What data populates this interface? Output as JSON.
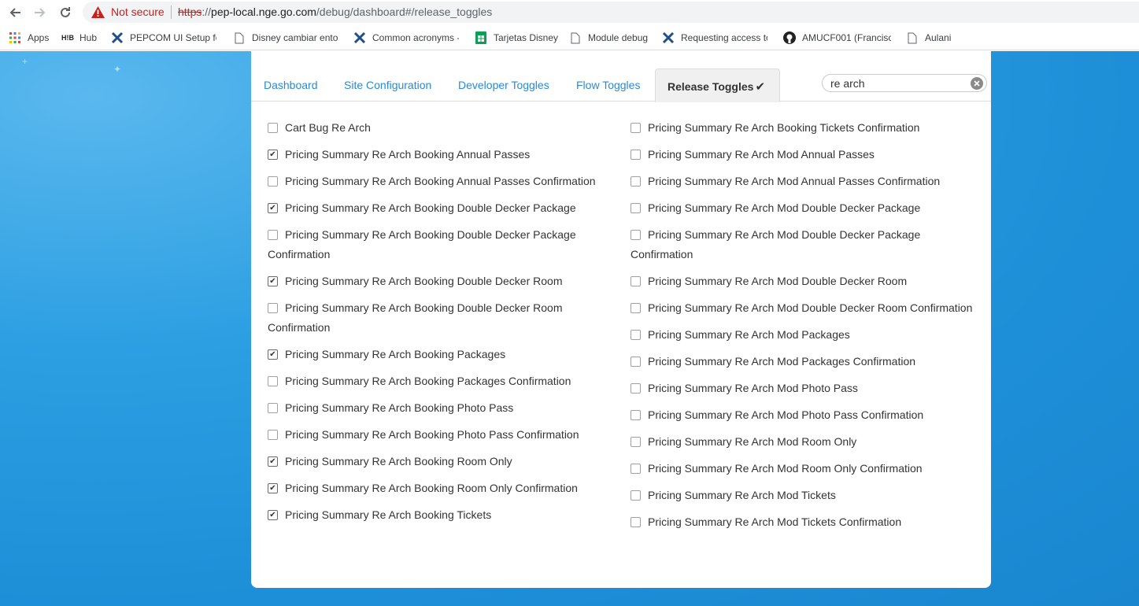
{
  "browser": {
    "security_label": "Not secure",
    "url_scheme": "https",
    "url_host": "pep-local.nge.go.com",
    "url_path": "/debug/dashboard#/release_toggles",
    "bookmarks": [
      {
        "label": "Apps",
        "icon": "apps-grid-icon"
      },
      {
        "label": "Hub",
        "icon": "hub-logo-icon"
      },
      {
        "label": "PEPCOM UI Setup fo",
        "icon": "confluence-icon"
      },
      {
        "label": "Disney cambiar ento",
        "icon": "page-icon"
      },
      {
        "label": "Common acronyms -",
        "icon": "confluence-icon"
      },
      {
        "label": "Tarjetas Disney",
        "icon": "sheets-icon"
      },
      {
        "label": "Module debug",
        "icon": "page-icon"
      },
      {
        "label": "Requesting access to",
        "icon": "confluence-icon"
      },
      {
        "label": "AMUCF001 (Francisc",
        "icon": "github-icon"
      },
      {
        "label": "Aulani",
        "icon": "page-icon"
      }
    ]
  },
  "tabs": [
    {
      "label": "Dashboard"
    },
    {
      "label": "Site Configuration"
    },
    {
      "label": "Developer Toggles"
    },
    {
      "label": "Flow Toggles"
    },
    {
      "label": "Release Toggles",
      "active": true,
      "check": "✔"
    }
  ],
  "search": {
    "value": "re arch"
  },
  "left_toggles": [
    {
      "label": "Cart Bug Re Arch",
      "checked": false
    },
    {
      "label": "Pricing Summary Re Arch Booking Annual Passes",
      "checked": true
    },
    {
      "label": "Pricing Summary Re Arch Booking Annual Passes Confirmation",
      "checked": false
    },
    {
      "label": "Pricing Summary Re Arch Booking Double Decker Package",
      "checked": true
    },
    {
      "label": "Pricing Summary Re Arch Booking Double Decker Package Confirmation",
      "checked": false
    },
    {
      "label": "Pricing Summary Re Arch Booking Double Decker Room",
      "checked": true
    },
    {
      "label": "Pricing Summary Re Arch Booking Double Decker Room Confirmation",
      "checked": false
    },
    {
      "label": "Pricing Summary Re Arch Booking Packages",
      "checked": true
    },
    {
      "label": "Pricing Summary Re Arch Booking Packages Confirmation",
      "checked": false
    },
    {
      "label": "Pricing Summary Re Arch Booking Photo Pass",
      "checked": false
    },
    {
      "label": "Pricing Summary Re Arch Booking Photo Pass Confirmation",
      "checked": false
    },
    {
      "label": "Pricing Summary Re Arch Booking Room Only",
      "checked": true
    },
    {
      "label": "Pricing Summary Re Arch Booking Room Only Confirmation",
      "checked": true
    },
    {
      "label": "Pricing Summary Re Arch Booking Tickets",
      "checked": true
    }
  ],
  "right_toggles": [
    {
      "label": "Pricing Summary Re Arch Booking Tickets Confirmation",
      "checked": false
    },
    {
      "label": "Pricing Summary Re Arch Mod Annual Passes",
      "checked": false
    },
    {
      "label": "Pricing Summary Re Arch Mod Annual Passes Confirmation",
      "checked": false
    },
    {
      "label": "Pricing Summary Re Arch Mod Double Decker Package",
      "checked": false
    },
    {
      "label": "Pricing Summary Re Arch Mod Double Decker Package Confirmation",
      "checked": false
    },
    {
      "label": "Pricing Summary Re Arch Mod Double Decker Room",
      "checked": false
    },
    {
      "label": "Pricing Summary Re Arch Mod Double Decker Room Confirmation",
      "checked": false
    },
    {
      "label": "Pricing Summary Re Arch Mod Packages",
      "checked": false
    },
    {
      "label": "Pricing Summary Re Arch Mod Packages Confirmation",
      "checked": false
    },
    {
      "label": "Pricing Summary Re Arch Mod Photo Pass",
      "checked": false
    },
    {
      "label": "Pricing Summary Re Arch Mod Photo Pass Confirmation",
      "checked": false
    },
    {
      "label": "Pricing Summary Re Arch Mod Room Only",
      "checked": false
    },
    {
      "label": "Pricing Summary Re Arch Mod Room Only Confirmation",
      "checked": false
    },
    {
      "label": "Pricing Summary Re Arch Mod Tickets",
      "checked": false
    },
    {
      "label": "Pricing Summary Re Arch Mod Tickets Confirmation",
      "checked": false
    }
  ],
  "colors": {
    "link": "#2a8ad3",
    "background": "#1d8fd8",
    "not_secure": "#c5221f"
  }
}
